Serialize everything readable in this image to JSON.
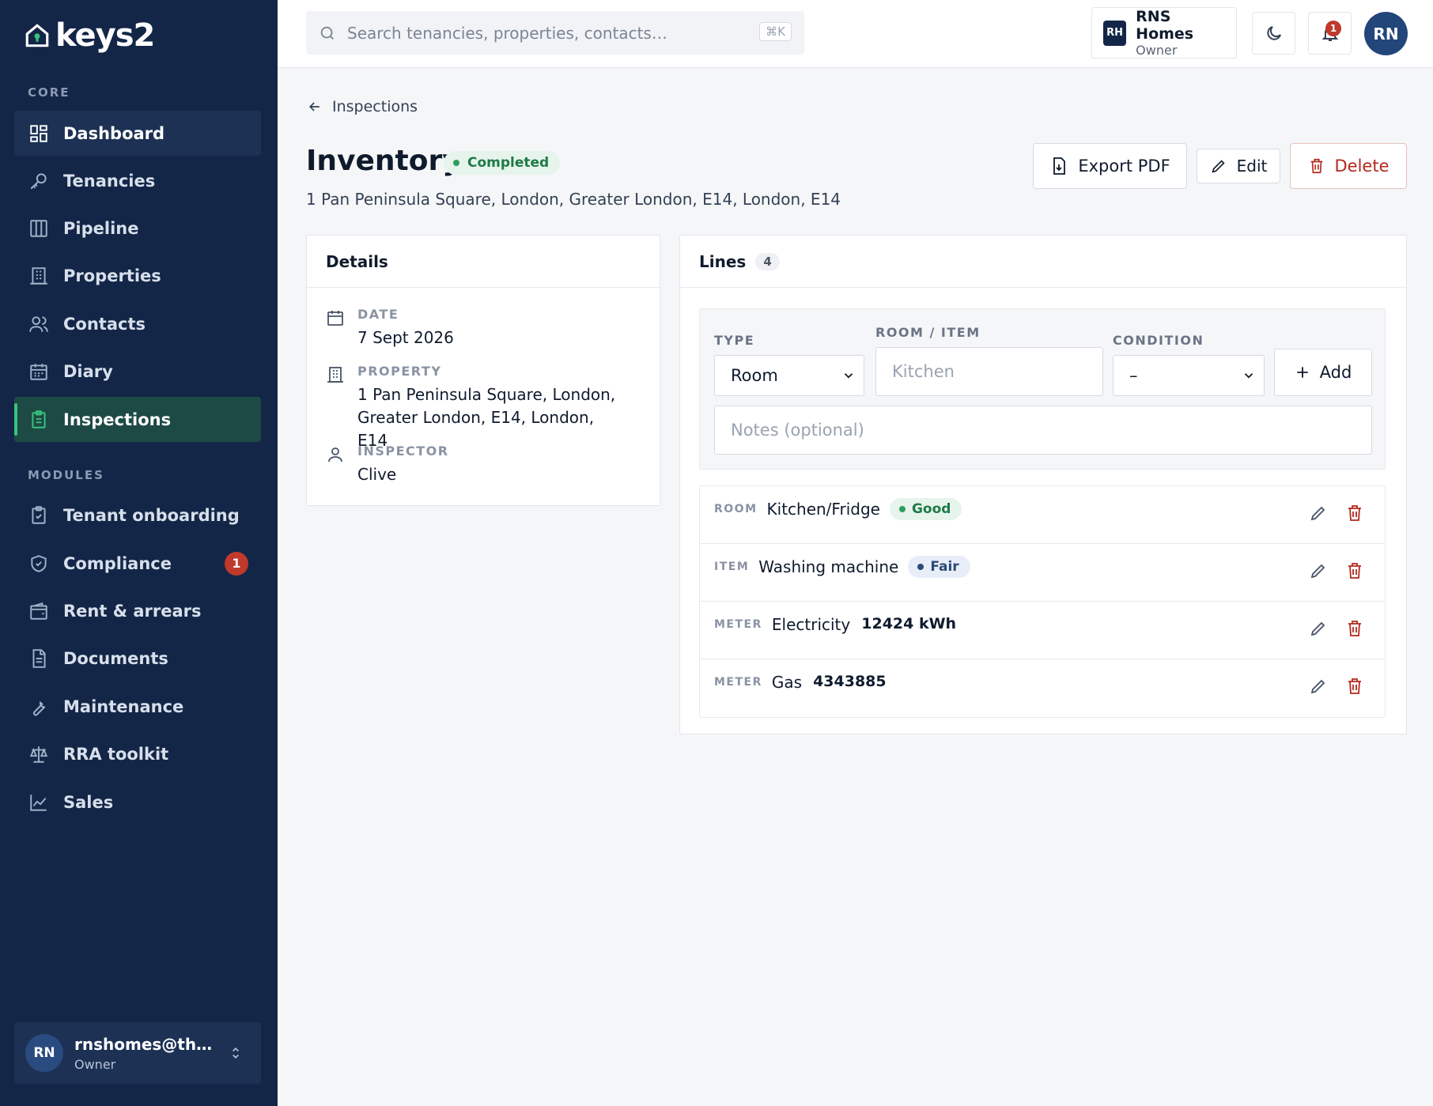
{
  "brand": {
    "name": "keys2"
  },
  "sidebar": {
    "core_label": "CORE",
    "modules_label": "MODULES",
    "core_items": [
      {
        "label": "Dashboard",
        "icon": "dashboard-icon"
      },
      {
        "label": "Tenancies",
        "icon": "key-icon"
      },
      {
        "label": "Pipeline",
        "icon": "pipeline-icon"
      },
      {
        "label": "Properties",
        "icon": "building-icon"
      },
      {
        "label": "Contacts",
        "icon": "contacts-icon"
      },
      {
        "label": "Diary",
        "icon": "calendar-icon"
      },
      {
        "label": "Inspections",
        "icon": "clipboard-icon"
      }
    ],
    "module_items": [
      {
        "label": "Tenant onboarding",
        "icon": "clipboard-check-icon"
      },
      {
        "label": "Compliance",
        "icon": "shield-icon",
        "badge": "1"
      },
      {
        "label": "Rent & arrears",
        "icon": "wallet-icon"
      },
      {
        "label": "Documents",
        "icon": "document-icon"
      },
      {
        "label": "Maintenance",
        "icon": "wrench-icon"
      },
      {
        "label": "RRA toolkit",
        "icon": "scales-icon"
      },
      {
        "label": "Sales",
        "icon": "chart-icon"
      }
    ],
    "user": {
      "initials": "RN",
      "email": "rnshomes@theoli…",
      "role": "Owner"
    }
  },
  "topbar": {
    "search_placeholder": "Search tenancies, properties, contacts…",
    "shortcut": "⌘K",
    "org": {
      "initials": "RH",
      "name": "RNS Homes",
      "role": "Owner"
    },
    "notifications": "1",
    "avatar_initials": "RN"
  },
  "page": {
    "back_label": "Inspections",
    "title": "Inventory",
    "status": "Completed",
    "address": "1 Pan Peninsula Square, London, Greater London, E14, London, E14",
    "actions": {
      "export": "Export PDF",
      "edit": "Edit",
      "delete": "Delete"
    }
  },
  "details": {
    "heading": "Details",
    "date_label": "DATE",
    "date_value": "7 Sept 2026",
    "property_label": "PROPERTY",
    "property_value": "1 Pan Peninsula Square, London, Greater London, E14, London, E14",
    "inspector_label": "INSPECTOR",
    "inspector_value": "Clive"
  },
  "lines": {
    "heading": "Lines",
    "count": "4",
    "form": {
      "type_label": "TYPE",
      "type_value": "Room",
      "item_label": "ROOM / ITEM",
      "item_placeholder": "Kitchen",
      "condition_label": "CONDITION",
      "condition_value": "–",
      "add_label": "Add",
      "notes_placeholder": "Notes (optional)"
    },
    "items": [
      {
        "kind": "ROOM",
        "name": "Kitchen/Fridge",
        "condition": "Good"
      },
      {
        "kind": "ITEM",
        "name": "Washing machine",
        "condition": "Fair"
      },
      {
        "kind": "METER",
        "name": "Electricity",
        "reading": "12424 kWh"
      },
      {
        "kind": "METER",
        "name": "Gas",
        "reading": "4343885"
      }
    ]
  },
  "colors": {
    "sidebar": "#132647",
    "active": "#1e4a45",
    "accent_green": "#37c47a",
    "danger": "#b4281c"
  }
}
